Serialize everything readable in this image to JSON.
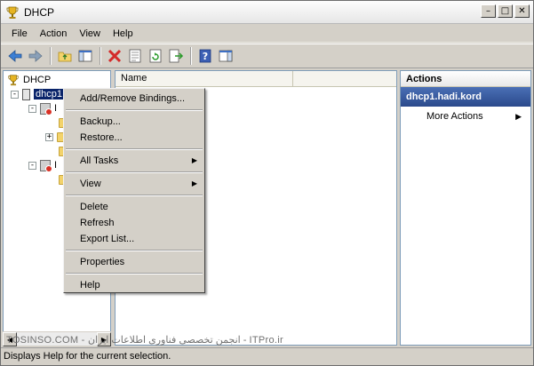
{
  "window": {
    "title": "DHCP"
  },
  "menubar": {
    "items": [
      "File",
      "Action",
      "View",
      "Help"
    ]
  },
  "toolbar": {
    "buttons": [
      "back-icon",
      "forward-icon",
      "up-folder-icon",
      "show-hide-tree-icon",
      "delete-icon",
      "properties-icon",
      "refresh-icon",
      "export-list-icon",
      "help-icon",
      "show-hide-action-pane-icon"
    ]
  },
  "tree": {
    "root": "DHCP",
    "server": "dhcp1.hadi.kord",
    "ipv4_label": "I",
    "ipv6_label": "I"
  },
  "list": {
    "columns": [
      "Name",
      ""
    ]
  },
  "actions": {
    "header": "Actions",
    "section": "dhcp1.hadi.kord",
    "items": [
      "More Actions"
    ]
  },
  "context_menu": {
    "items": [
      {
        "label": "Add/Remove Bindings...",
        "submenu": false
      },
      {
        "label": "Backup...",
        "submenu": false
      },
      {
        "label": "Restore...",
        "submenu": false
      },
      {
        "label": "All Tasks",
        "submenu": true
      },
      {
        "label": "View",
        "submenu": true
      },
      {
        "label": "Delete",
        "submenu": false
      },
      {
        "label": "Refresh",
        "submenu": false
      },
      {
        "label": "Export List...",
        "submenu": false
      },
      {
        "label": "Properties",
        "submenu": false
      },
      {
        "label": "Help",
        "submenu": false
      }
    ]
  },
  "status": {
    "text": "Displays Help for the current selection.",
    "watermark": "TOSINSO.COM - انجمن تخصصی فناوری اطلاعات ایران - ITPro.ir"
  },
  "colors": {
    "selection": "#0a246a",
    "actions_section": "#2b4a8c",
    "window_bg": "#d4d0c8"
  }
}
